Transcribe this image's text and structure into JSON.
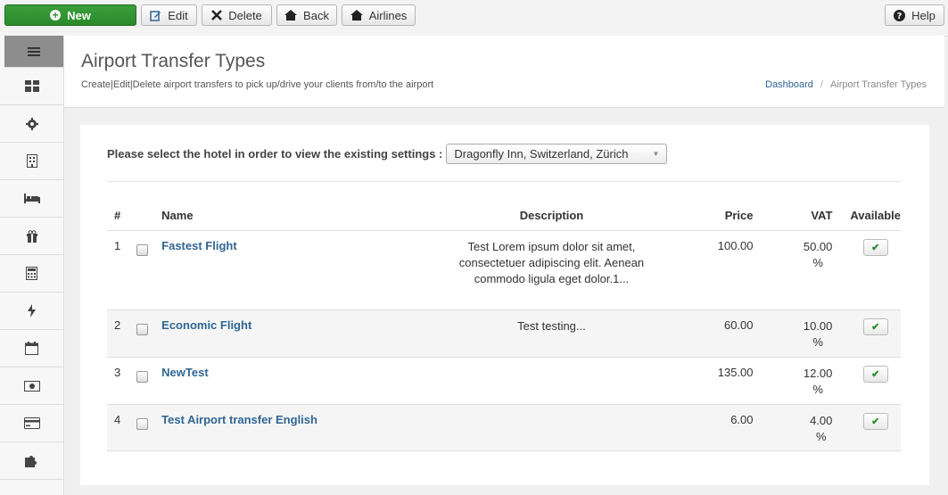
{
  "toolbar": {
    "new_label": "New",
    "edit_label": "Edit",
    "delete_label": "Delete",
    "back_label": "Back",
    "airlines_label": "Airlines",
    "help_label": "Help"
  },
  "sidebar": {
    "items": [
      {
        "icon": "menu-icon"
      },
      {
        "icon": "dashboard-icon"
      },
      {
        "icon": "gear-icon"
      },
      {
        "icon": "building-icon"
      },
      {
        "icon": "bed-icon"
      },
      {
        "icon": "gift-icon"
      },
      {
        "icon": "calculator-icon"
      },
      {
        "icon": "bolt-icon"
      },
      {
        "icon": "calendar-icon"
      },
      {
        "icon": "money-icon"
      },
      {
        "icon": "credit-card-icon"
      },
      {
        "icon": "puzzle-icon"
      }
    ]
  },
  "header": {
    "title": "Airport Transfer Types",
    "subtitle": "Create|Edit|Delete airport transfers to pick up/drive your clients from/to the airport",
    "breadcrumb": {
      "home": "Dashboard",
      "separator": "/",
      "current": "Airport Transfer Types"
    }
  },
  "hotel_select": {
    "label": "Please select the hotel in order to view the existing settings :",
    "value": "Dragonfly Inn, Switzerland, Zürich"
  },
  "table": {
    "headers": {
      "num": "#",
      "name": "Name",
      "description": "Description",
      "price": "Price",
      "vat": "VAT",
      "available": "Available"
    },
    "rows": [
      {
        "num": "1",
        "name": "Fastest Flight",
        "description": "Test Lorem ipsum dolor sit amet, consectetuer adipiscing elit. Aenean commodo ligula eget dolor.1...",
        "price": "100.00",
        "vat": "50.00",
        "vat_unit": "%"
      },
      {
        "num": "2",
        "name": "Economic Flight",
        "description": "Test testing...",
        "price": "60.00",
        "vat": "10.00",
        "vat_unit": "%"
      },
      {
        "num": "3",
        "name": "NewTest",
        "description": "",
        "price": "135.00",
        "vat": "12.00",
        "vat_unit": "%"
      },
      {
        "num": "4",
        "name": "Test Airport transfer English",
        "description": "",
        "price": "6.00",
        "vat": "4.00",
        "vat_unit": "%"
      }
    ]
  },
  "colors": {
    "accent": "#2f6694",
    "new_button": "#2f8f2f",
    "check": "#2c8a2c"
  }
}
